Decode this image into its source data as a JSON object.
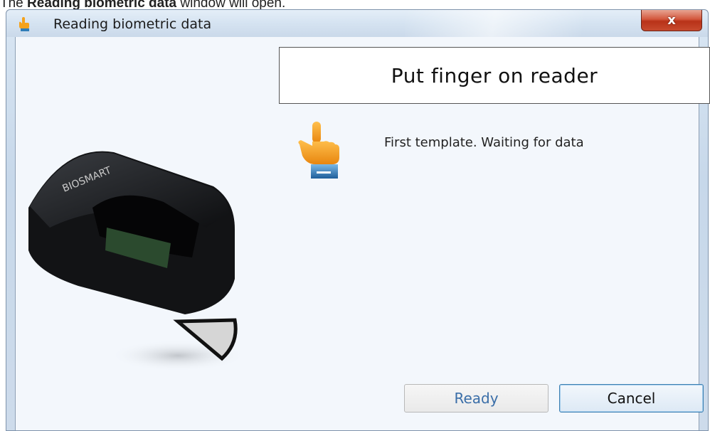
{
  "caption": {
    "prefix": "The ",
    "bold": "Reading biometric data",
    "suffix": " window will open."
  },
  "window": {
    "title": "Reading biometric data",
    "close_label": "x",
    "title_icon": "hand-pointer-icon"
  },
  "instruction": "Put finger on reader",
  "status": "First template. Waiting for data",
  "device": {
    "brand": "BIOSMART",
    "icon": "fingerprint-reader-icon"
  },
  "buttons": {
    "ready": "Ready",
    "cancel": "Cancel"
  },
  "colors": {
    "ready_text": "#3a6ea8",
    "close_red": "#c74a2e",
    "hand_orange": "#f4a21c",
    "cuff_blue": "#2f7db8"
  }
}
